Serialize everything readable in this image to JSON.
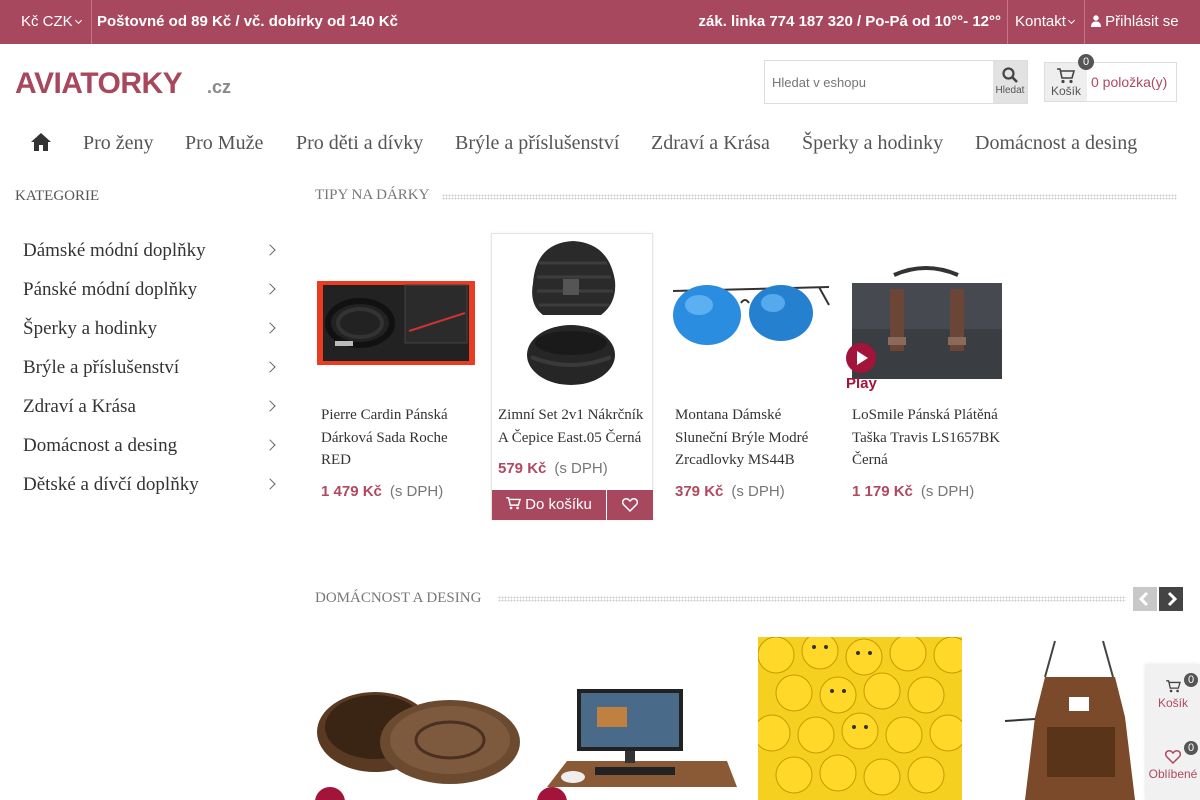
{
  "topbar": {
    "currency": "Kč CZK",
    "shipping": "Poštovné od 89 Kč / vč. dobírky od 140 Kč",
    "hotline": "zák. linka 774 187 320 / Po-Pá od 10°°- 12°°",
    "contact": "Kontakt",
    "login": "Přihlásit se"
  },
  "header": {
    "logo_text": "AVIATORKY.cz",
    "search_placeholder": "Hledat v eshopu",
    "search_button": "Hledat",
    "cart_label": "Košík",
    "cart_count": "0",
    "cart_text": "0 položka(y)"
  },
  "nav": {
    "items": [
      "Pro ženy",
      "Pro Muže",
      "Pro děti a dívky",
      "Brýle a příslušenství",
      "Zdraví a Krása",
      "Šperky a hodinky",
      "Domácnost a desing"
    ]
  },
  "sidebar": {
    "title": "KATEGORIE",
    "items": [
      "Dámské módní doplňky",
      "Pánské módní doplňky",
      "Šperky a hodinky",
      "Brýle a příslušenství",
      "Zdraví a Krása",
      "Domácnost a desing",
      "Dětské a dívčí doplňky"
    ]
  },
  "tips": {
    "title": "TIPY NA DÁRKY",
    "products": [
      {
        "name": "Pierre Cardin Pánská Dárková Sada Roche RED",
        "price": "1 479 Kč",
        "vat": "(s DPH)"
      },
      {
        "name": "Zimní Set 2v1 Nákrčník A Čepice East.05 Černá",
        "price": "579 Kč",
        "vat": "(s DPH)"
      },
      {
        "name": "Montana Dámské Sluneční Brýle Modré Zrcadlovky MS44B",
        "price": "379 Kč",
        "vat": "(s DPH)"
      },
      {
        "name": "LoSmile Pánská Plátěná Taška Travis LS1657BK Černá",
        "price": "1 179 Kč",
        "vat": "(s DPH)"
      }
    ],
    "add_to_cart": "Do košíku",
    "play": "Play"
  },
  "home_section": {
    "title": "DOMÁCNOST A DESING"
  },
  "floating": {
    "cart_label": "Košík",
    "cart_count": "0",
    "fav_label": "Oblíbené",
    "fav_count": "0"
  },
  "colors": {
    "brand": "#a8485e",
    "price": "#b0495f",
    "play": "#a2143a"
  }
}
